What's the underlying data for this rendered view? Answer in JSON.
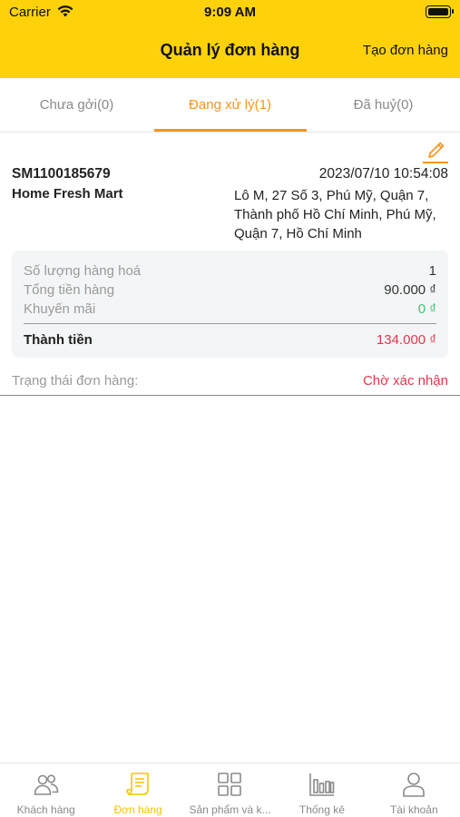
{
  "status_bar": {
    "carrier": "Carrier",
    "time": "9:09 AM"
  },
  "nav": {
    "title": "Quản lý đơn hàng",
    "create_label": "Tạo đơn hàng"
  },
  "tabs": [
    {
      "label": "Chưa gởi(0)"
    },
    {
      "label": "Đang xử lý(1)",
      "active": true
    },
    {
      "label": "Đã huỷ(0)"
    }
  ],
  "order": {
    "id": "SM1100185679",
    "datetime": "2023/07/10 10:54:08",
    "store": "Home Fresh Mart",
    "address": "Lô M, 27 Số 3, Phú Mỹ, Quận 7, Thành phố Hồ Chí Minh, Phú Mỹ, Quận 7, Hồ Chí Minh",
    "summary": {
      "quantity_label": "Số lượng hàng hoá",
      "quantity_value": "1",
      "subtotal_label": "Tổng tiền hàng",
      "subtotal_value": "90.000 ₫",
      "discount_label": "Khuyến mãi",
      "discount_value": "0 ₫",
      "total_label": "Thành tiền",
      "total_value": "134.000 ₫"
    },
    "status_label": "Trạng thái đơn hàng:",
    "status_value": "Chờ xác nhận"
  },
  "bottom_nav": [
    {
      "label": "Khách hàng",
      "icon": "customers-icon"
    },
    {
      "label": "Đơn hàng",
      "icon": "orders-icon",
      "active": true
    },
    {
      "label": "Sản phẩm và k...",
      "icon": "products-icon"
    },
    {
      "label": "Thống kê",
      "icon": "statistics-icon"
    },
    {
      "label": "Tài khoản",
      "icon": "account-icon"
    }
  ],
  "colors": {
    "header": "#FDD20B",
    "accent_tab": "#F7941D",
    "active_nav": "#F5C400",
    "danger": "#E8344E",
    "success": "#2ecc71"
  }
}
